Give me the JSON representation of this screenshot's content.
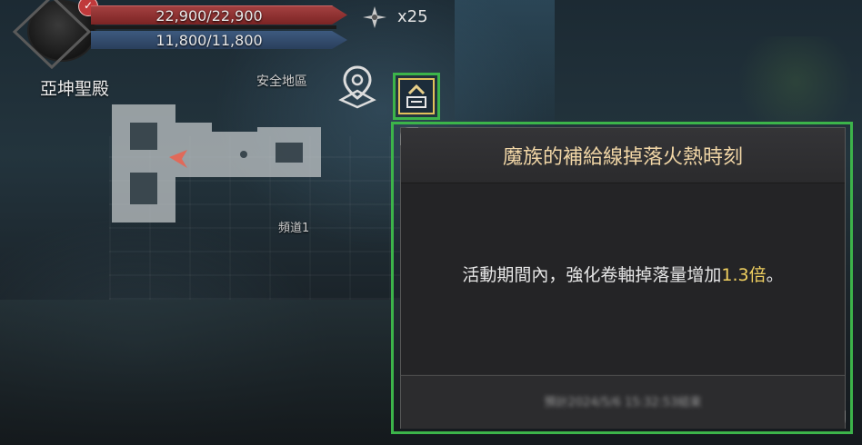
{
  "player": {
    "hp": "22,900/22,900",
    "mp": "11,800/11,800",
    "hp_color": "#9b3a3a",
    "mp_color": "#3a5478",
    "alert_badge": "✓"
  },
  "currency": {
    "icon": "compass-star-icon",
    "count": "x25"
  },
  "location": {
    "name": "亞坤聖殿",
    "zone_status": "安全地區",
    "channel": "頻道1"
  },
  "event_button": {
    "icon": "chevron-up-scroll-icon",
    "border_color": "#3cb44a"
  },
  "popup": {
    "title": "魔族的補給線掉落火熱時刻",
    "message_prefix": "活動期間內，強化卷軸掉落量增加",
    "message_highlight": "1.3倍",
    "message_suffix": "。",
    "highlight_color": "#f0d060",
    "end_time": "預計2024/5/6 15:32:53結束"
  }
}
